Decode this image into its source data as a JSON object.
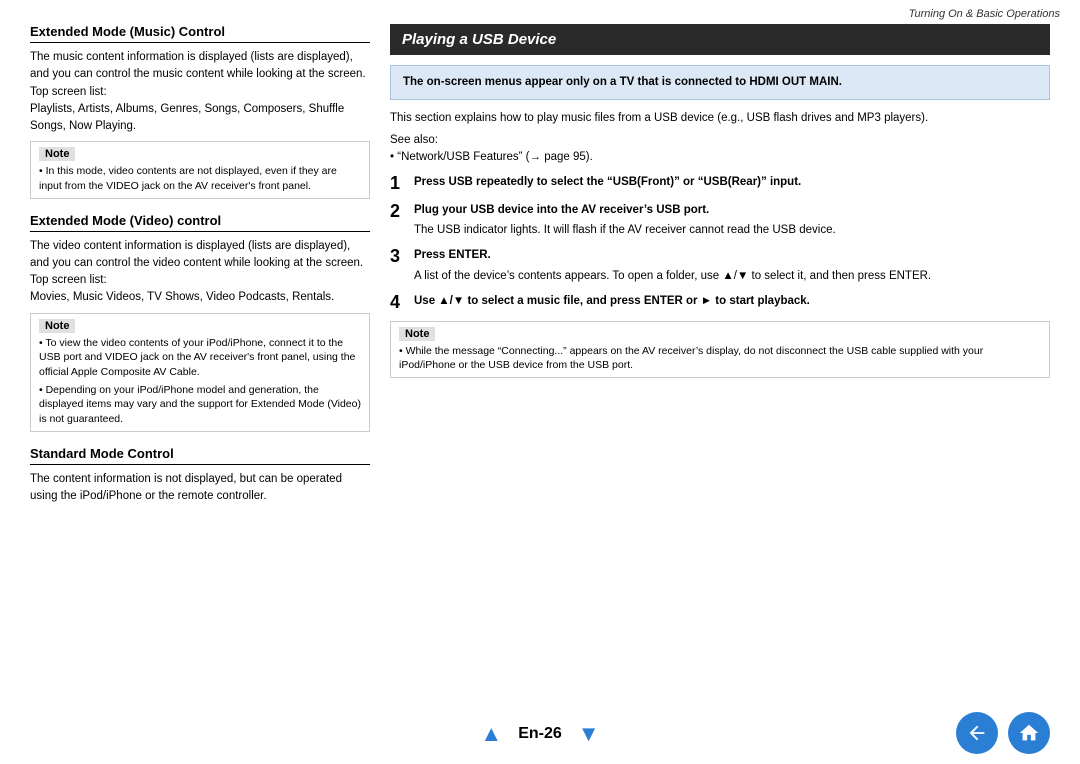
{
  "header": {
    "chapter_title": "Turning On & Basic Operations"
  },
  "left_col": {
    "sections": [
      {
        "id": "ext-music",
        "title": "Extended Mode (Music) Control",
        "body": "The music content information is displayed (lists are displayed), and you can control the music content while looking at the screen.",
        "top_screen_list_label": "Top screen list:",
        "top_screen_list": "Playlists, Artists, Albums, Genres, Songs, Composers, Shuffle Songs, Now Playing.",
        "note": {
          "label": "Note",
          "items": [
            "In this mode, video contents are not displayed, even if they are input from the VIDEO jack on the AV receiver's front panel."
          ]
        }
      },
      {
        "id": "ext-video",
        "title": "Extended Mode (Video) control",
        "body": "The video content information is displayed (lists are displayed), and you can control the video content while looking at the screen.",
        "top_screen_list_label": "Top screen list:",
        "top_screen_list": "Movies, Music Videos, TV Shows, Video Podcasts, Rentals.",
        "note": {
          "label": "Note",
          "items": [
            "To view the video contents of your iPod/iPhone, connect it to the USB port and VIDEO jack on the AV receiver's front panel, using the official Apple Composite AV Cable.",
            "Depending on your iPod/iPhone model and generation, the displayed items may vary and the support for Extended Mode (Video) is not guaranteed."
          ]
        }
      },
      {
        "id": "std-mode",
        "title": "Standard Mode Control",
        "body": "The content information is not displayed, but can be operated using the iPod/iPhone or the remote controller."
      }
    ]
  },
  "right_col": {
    "section_title": "Playing a USB Device",
    "hdmi_note": "The on-screen menus appear only on a TV that is connected to HDMI OUT MAIN.",
    "intro": "This section explains how to play music files from a USB device (e.g., USB flash drives and MP3 players).",
    "see_also_label": "See also:",
    "see_also_link": "“Network/USB Features” (→ page 95).",
    "steps": [
      {
        "num": "1",
        "bold": "Press USB repeatedly to select the “USB(Front)” or “USB(Rear)” input."
      },
      {
        "num": "2",
        "bold": "Plug your USB device into the AV receiver’s USB port.",
        "sub": "The USB indicator lights. It will flash if the AV receiver cannot read the USB device."
      },
      {
        "num": "3",
        "bold": "Press ENTER.",
        "sub": "A list of the device’s contents appears. To open a folder, use ▲/▼ to select it, and then press ENTER."
      },
      {
        "num": "4",
        "bold": "Use ▲/▼ to select a music file, and press ENTER or ► to start playback."
      }
    ],
    "note": {
      "label": "Note",
      "items": [
        "While the message “Connecting...” appears on the AV receiver’s display, do not disconnect the USB cable supplied with your iPod/iPhone or the USB device from the USB port."
      ]
    }
  },
  "footer": {
    "page_label": "En-26",
    "up_arrow": "▲",
    "down_arrow": "▼"
  }
}
